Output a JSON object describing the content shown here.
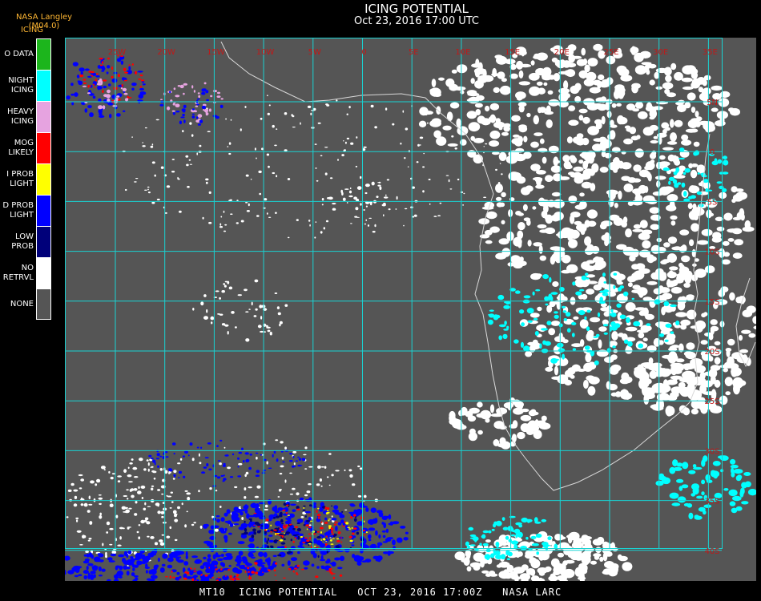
{
  "header": {
    "title": "ICING POTENTIAL",
    "subtitle": "Oct 23, 2016 17:00 UTC",
    "source": "NASA Langley (M04.0)",
    "legend_title": "ICING"
  },
  "legend": [
    {
      "label": "O DATA",
      "color": "#1cb51c"
    },
    {
      "label": "NIGHT\nICING",
      "color": "#00ffff"
    },
    {
      "label": "HEAVY\nICING",
      "color": "#e6a3e0"
    },
    {
      "label": "MOG\nLIKELY",
      "color": "#ff0000"
    },
    {
      "label": "I PROB\nLIGHT",
      "color": "#ffff00"
    },
    {
      "label": "D PROB\nLIGHT",
      "color": "#0000ff"
    },
    {
      "label": "LOW\nPROB",
      "color": "#00007a"
    },
    {
      "label": "NO\nRETRVL",
      "color": "#ffffff"
    },
    {
      "label": "NONE",
      "color": "#555555"
    }
  ],
  "map": {
    "background": "#555555",
    "grid_color": "#19d3d3",
    "label_color": "#c01818",
    "top_labels": [
      "25W",
      "20W",
      "15W",
      "10W",
      "5W",
      "0",
      "5E",
      "10E",
      "15E",
      "20E",
      "25E",
      "30E",
      "35E"
    ],
    "right_labels": [
      "5N",
      "0",
      "5S",
      "10S",
      "15S",
      "20S",
      "25S",
      "30S",
      "35S",
      "40S"
    ]
  },
  "footer": {
    "text": "MT10  ICING POTENTIAL   OCT 23, 2016 17:00Z   NASA LARC"
  }
}
